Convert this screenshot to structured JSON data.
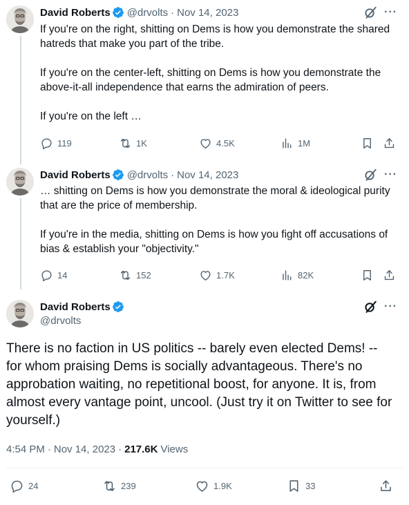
{
  "tweets": [
    {
      "author": "David Roberts",
      "handle": "@drvolts",
      "date": "Nov 14, 2023",
      "separator": "·",
      "paragraphs": [
        "If you're on the right, shitting on Dems is how you demonstrate the shared hatreds that make you part of the tribe.",
        "If you're on the center-left, shitting on Dems is how you demonstrate the above-it-all independence that earns the admiration of peers.",
        "If you're on the left …"
      ],
      "replies": "119",
      "retweets": "1K",
      "likes": "4.5K",
      "views": "1M"
    },
    {
      "author": "David Roberts",
      "handle": "@drvolts",
      "date": "Nov 14, 2023",
      "separator": "·",
      "paragraphs": [
        "… shitting on Dems is how you demonstrate the moral & ideological purity that are the price of membership.",
        "If you're in the media, shitting on Dems is how you fight off accusations of bias & establish your \"objectivity.\""
      ],
      "replies": "14",
      "retweets": "152",
      "likes": "1.7K",
      "views": "82K"
    }
  ],
  "main_tweet": {
    "author": "David Roberts",
    "handle": "@drvolts",
    "text": "There is no faction in US politics -- barely even elected Dems! -- for whom praising Dems is socially advantageous. There's no approbation waiting, no repetitional boost, for anyone. It is, from almost every vantage point, uncool.  (Just try it on Twitter to see for yourself.)",
    "time": "4:54 PM",
    "date": "Nov 14, 2023",
    "separator": "·",
    "view_count": "217.6K",
    "views_label": "Views",
    "replies": "24",
    "retweets": "239",
    "likes": "1.9K",
    "bookmarks": "33"
  },
  "colors": {
    "verified": "#1d9bf0",
    "muted": "#536471",
    "text": "#0f1419",
    "thread_line": "#cfd9de"
  },
  "icons": [
    "verified-badge-icon",
    "grok-slash-icon",
    "more-icon",
    "reply-icon",
    "retweet-icon",
    "like-icon",
    "views-icon",
    "bookmark-icon",
    "share-icon"
  ]
}
